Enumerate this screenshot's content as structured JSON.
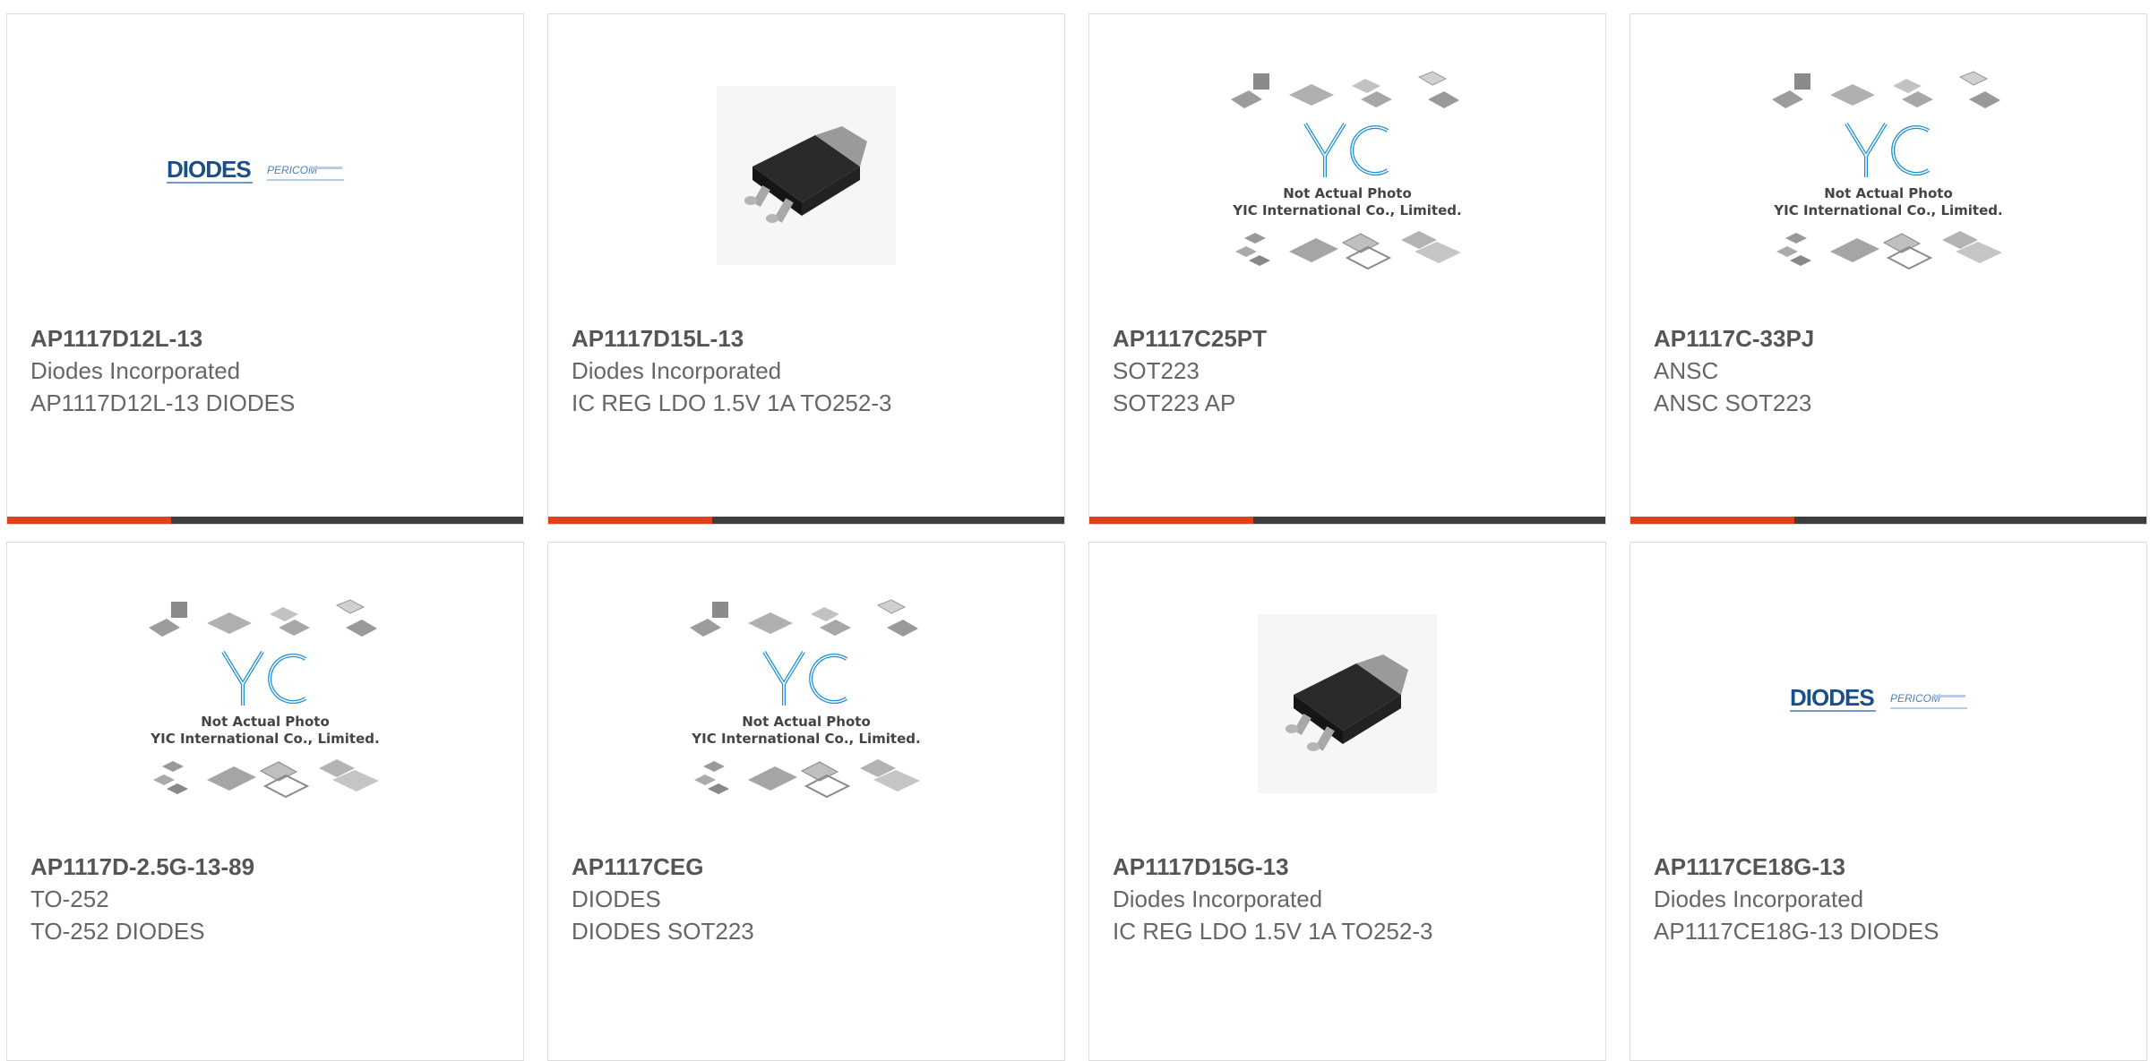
{
  "colors": {
    "accent": "#e0401c",
    "bar": "#3d3d3d",
    "yic_blue": "#1c8fd6",
    "diodes_blue": "#1b4f8c"
  },
  "products": [
    {
      "part_number": "AP1117D12L-13",
      "manufacturer": "Diodes Incorporated",
      "description": "AP1117D12L-13 DIODES",
      "image": "diodes-logo",
      "logo_text": "DIODES",
      "logo_sub": "PERICOM"
    },
    {
      "part_number": "AP1117D15L-13",
      "manufacturer": "Diodes Incorporated",
      "description": "IC REG LDO 1.5V 1A TO252-3",
      "image": "to252-package"
    },
    {
      "part_number": "AP1117C25PT",
      "manufacturer": "SOT223",
      "description": "SOT223 AP",
      "image": "yic-placeholder",
      "yic_line1": "Not Actual Photo",
      "yic_line2": "YIC International Co., Limited."
    },
    {
      "part_number": "AP1117C-33PJ",
      "manufacturer": "ANSC",
      "description": "ANSC SOT223",
      "image": "yic-placeholder",
      "yic_line1": "Not Actual Photo",
      "yic_line2": "YIC International Co., Limited."
    },
    {
      "part_number": "AP1117D-2.5G-13-89",
      "manufacturer": "TO-252",
      "description": "TO-252 DIODES",
      "image": "yic-placeholder",
      "yic_line1": "Not Actual Photo",
      "yic_line2": "YIC International Co., Limited."
    },
    {
      "part_number": "AP1117CEG",
      "manufacturer": "DIODES",
      "description": "DIODES SOT223",
      "image": "yic-placeholder",
      "yic_line1": "Not Actual Photo",
      "yic_line2": "YIC International Co., Limited."
    },
    {
      "part_number": "AP1117D15G-13",
      "manufacturer": "Diodes Incorporated",
      "description": "IC REG LDO 1.5V 1A TO252-3",
      "image": "to252-package"
    },
    {
      "part_number": "AP1117CE18G-13",
      "manufacturer": "Diodes Incorporated",
      "description": "AP1117CE18G-13 DIODES",
      "image": "diodes-logo",
      "logo_text": "DIODES",
      "logo_sub": "PERICOM"
    }
  ]
}
